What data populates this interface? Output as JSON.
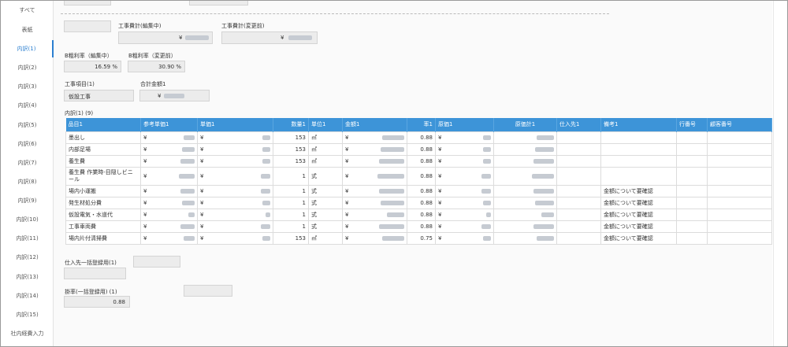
{
  "sidebar": {
    "items": [
      "すべて",
      "表紙",
      "内訳(1)",
      "内訳(2)",
      "内訳(3)",
      "内訳(4)",
      "内訳(5)",
      "内訳(6)",
      "内訳(7)",
      "内訳(8)",
      "内訳(9)",
      "内訳(10)",
      "内訳(11)",
      "内訳(12)",
      "内訳(13)",
      "内訳(14)",
      "内訳(15)",
      "社内経費入力"
    ],
    "active_index": 2
  },
  "summary": {
    "cost_editing_label": "工事費計(編集中)",
    "cost_before_label": "工事費計(変更前)",
    "yen": "¥",
    "gross_editing_label": "B粗利率（編集中）",
    "gross_before_label": "B粗利率（変更前）",
    "gross_editing_value": "16.59 %",
    "gross_before_value": "30.90 %",
    "item_label": "工事項目(1)",
    "item_value": "仮設工事",
    "total_label": "合計金額1"
  },
  "table": {
    "title": "内訳(1) (9)",
    "headers": [
      "品目1",
      "参考単価1",
      "単価1",
      "数量1",
      "単位1",
      "金額1",
      "率1",
      "原価1",
      "原価計1",
      "仕入先1",
      "備考1",
      "行番号",
      "顧客番号"
    ],
    "rows": [
      {
        "name": "墨出し",
        "qty": "153",
        "unit": "㎡",
        "rate": "0.88",
        "note": ""
      },
      {
        "name": "内部足場",
        "qty": "153",
        "unit": "㎡",
        "rate": "0.88",
        "note": ""
      },
      {
        "name": "養生費",
        "qty": "153",
        "unit": "㎡",
        "rate": "0.88",
        "note": ""
      },
      {
        "name": "養生費 作業時-目隠しビニール",
        "qty": "1",
        "unit": "式",
        "rate": "0.88",
        "note": ""
      },
      {
        "name": "場内小運搬",
        "qty": "1",
        "unit": "式",
        "rate": "0.88",
        "note": "金額について要確認"
      },
      {
        "name": "発生材処分費",
        "qty": "1",
        "unit": "式",
        "rate": "0.88",
        "note": "金額について要確認"
      },
      {
        "name": "仮設電気・水道代",
        "qty": "1",
        "unit": "式",
        "rate": "0.88",
        "note": "金額について要確認"
      },
      {
        "name": "工事車両費",
        "qty": "1",
        "unit": "式",
        "rate": "0.88",
        "note": "金額について要確認"
      },
      {
        "name": "場内片付清掃費",
        "qty": "153",
        "unit": "㎡",
        "rate": "0.75",
        "note": "金額について要確認"
      }
    ]
  },
  "bottom": {
    "supplier_label": "仕入先一括登録用(1)",
    "rate_label": "掛率(一括登録用) (1)",
    "rate_value": "0.88"
  }
}
